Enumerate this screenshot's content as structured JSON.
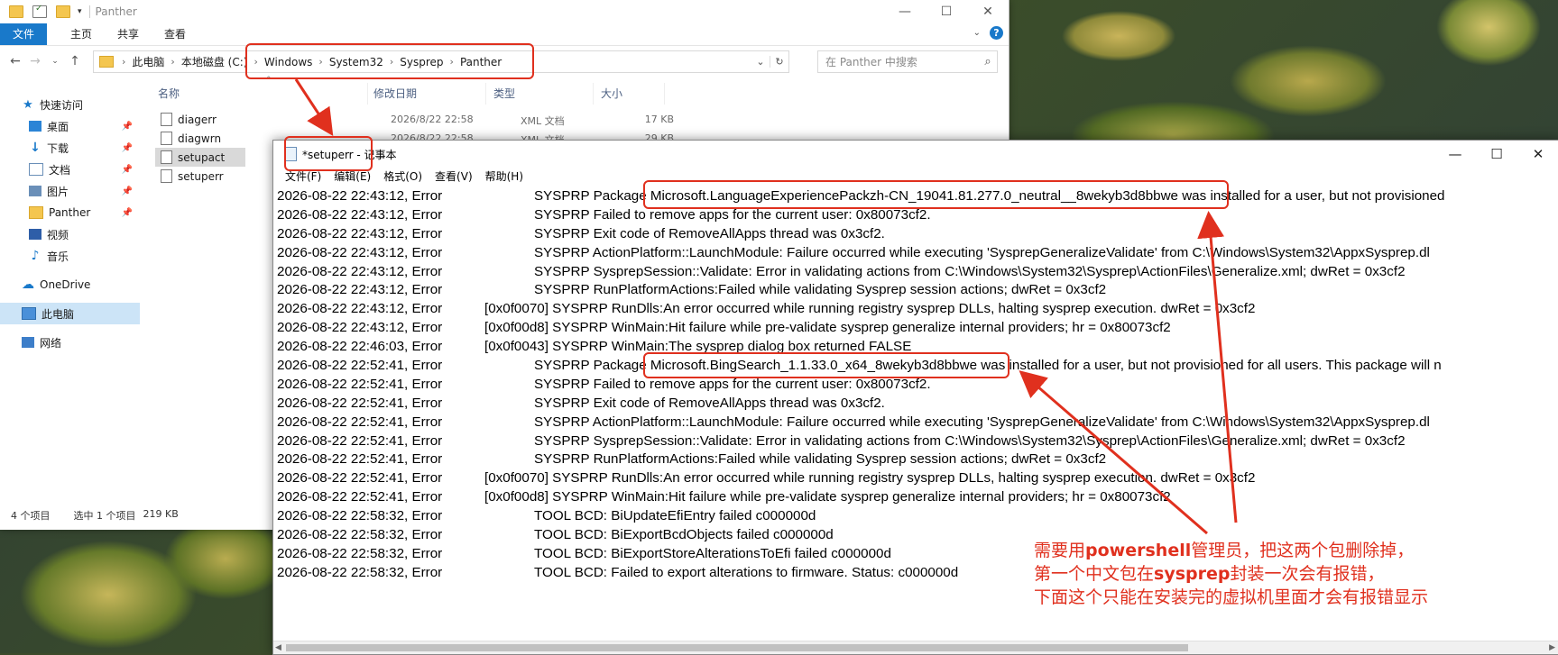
{
  "explorer": {
    "window_title": "Panther",
    "ribbon_tabs": [
      "文件",
      "主页",
      "共享",
      "查看"
    ],
    "breadcrumbs": [
      "此电脑",
      "本地磁盘 (C:)",
      "Windows",
      "System32",
      "Sysprep",
      "Panther"
    ],
    "search_placeholder": "在 Panther 中搜索",
    "nav_items": [
      {
        "label": "快速访问",
        "icon": "star-icon"
      },
      {
        "label": "桌面",
        "icon": "desktop-icon",
        "pinned": true
      },
      {
        "label": "下载",
        "icon": "download-icon",
        "pinned": true
      },
      {
        "label": "文档",
        "icon": "document-icon",
        "pinned": true
      },
      {
        "label": "图片",
        "icon": "pictures-icon",
        "pinned": true
      },
      {
        "label": "Panther",
        "icon": "folder-icon",
        "pinned": true
      },
      {
        "label": "视频",
        "icon": "video-icon"
      },
      {
        "label": "音乐",
        "icon": "music-icon"
      },
      {
        "label": "OneDrive",
        "icon": "cloud-icon"
      },
      {
        "label": "此电脑",
        "icon": "computer-icon",
        "selected": true
      },
      {
        "label": "网络",
        "icon": "network-icon"
      }
    ],
    "columns": [
      "名称",
      "修改日期",
      "类型",
      "大小"
    ],
    "files": [
      {
        "name": "diagerr",
        "date": "2026/8/22 22:58",
        "type": "XML 文档",
        "size": "17 KB"
      },
      {
        "name": "diagwrn",
        "date": "2026/8/22 22:58",
        "type": "XML 文档",
        "size": "29 KB"
      },
      {
        "name": "setupact",
        "date": "",
        "type": "",
        "size": "",
        "selected": true
      },
      {
        "name": "setuperr",
        "date": "",
        "type": "",
        "size": ""
      }
    ],
    "status": {
      "count": "4 个项目",
      "selected": "选中 1 个项目",
      "size": "219 KB"
    }
  },
  "notepad": {
    "title": "*setuperr - 记事本",
    "menu": [
      "文件(F)",
      "编辑(E)",
      "格式(O)",
      "查看(V)",
      "帮助(H)"
    ],
    "lines": [
      {
        "ts": "2026-08-22 22:43:12, Error",
        "msg": "SYSPRP Package Microsoft.LanguageExperiencePackzh-CN_19041.81.277.0_neutral__8wekyb3d8bbwe was installed for a user, but not provisioned",
        "indent": "wide"
      },
      {
        "ts": "2026-08-22 22:43:12, Error",
        "msg": "SYSPRP Failed to remove apps for the current user: 0x80073cf2.",
        "indent": "wide"
      },
      {
        "ts": "2026-08-22 22:43:12, Error",
        "msg": "SYSPRP Exit code of RemoveAllApps thread was 0x3cf2.",
        "indent": "wide"
      },
      {
        "ts": "2026-08-22 22:43:12, Error",
        "msg": "SYSPRP ActionPlatform::LaunchModule: Failure occurred while executing 'SysprepGeneralizeValidate' from C:\\Windows\\System32\\AppxSysprep.dl",
        "indent": "wide"
      },
      {
        "ts": "2026-08-22 22:43:12, Error",
        "msg": "SYSPRP SysprepSession::Validate: Error in validating actions from C:\\Windows\\System32\\Sysprep\\ActionFiles\\Generalize.xml; dwRet = 0x3cf2",
        "indent": "wide"
      },
      {
        "ts": "2026-08-22 22:43:12, Error",
        "msg": "SYSPRP RunPlatformActions:Failed while validating Sysprep session actions; dwRet = 0x3cf2",
        "indent": "wide"
      },
      {
        "ts": "2026-08-22 22:43:12, Error",
        "msg": "[0x0f0070] SYSPRP RunDlls:An error occurred while running registry sysprep DLLs, halting sysprep execution. dwRet = 0x3cf2",
        "indent": "narrow"
      },
      {
        "ts": "2026-08-22 22:43:12, Error",
        "msg": "[0x0f00d8] SYSPRP WinMain:Hit failure while pre-validate sysprep generalize internal providers; hr = 0x80073cf2",
        "indent": "narrow"
      },
      {
        "ts": "2026-08-22 22:46:03, Error",
        "msg": "[0x0f0043] SYSPRP WinMain:The sysprep dialog box returned FALSE",
        "indent": "narrow"
      },
      {
        "ts": "2026-08-22 22:52:41, Error",
        "msg": "SYSPRP Package Microsoft.BingSearch_1.1.33.0_x64_8wekyb3d8bbwe was installed for a user, but not provisioned for all users. This package will n",
        "indent": "wide"
      },
      {
        "ts": "2026-08-22 22:52:41, Error",
        "msg": "SYSPRP Failed to remove apps for the current user: 0x80073cf2.",
        "indent": "wide"
      },
      {
        "ts": "2026-08-22 22:52:41, Error",
        "msg": "SYSPRP Exit code of RemoveAllApps thread was 0x3cf2.",
        "indent": "wide"
      },
      {
        "ts": "2026-08-22 22:52:41, Error",
        "msg": "SYSPRP ActionPlatform::LaunchModule: Failure occurred while executing 'SysprepGeneralizeValidate' from C:\\Windows\\System32\\AppxSysprep.dl",
        "indent": "wide"
      },
      {
        "ts": "2026-08-22 22:52:41, Error",
        "msg": "SYSPRP SysprepSession::Validate: Error in validating actions from C:\\Windows\\System32\\Sysprep\\ActionFiles\\Generalize.xml; dwRet = 0x3cf2",
        "indent": "wide"
      },
      {
        "ts": "2026-08-22 22:52:41, Error",
        "msg": "SYSPRP RunPlatformActions:Failed while validating Sysprep session actions; dwRet = 0x3cf2",
        "indent": "wide"
      },
      {
        "ts": "2026-08-22 22:52:41, Error",
        "msg": "[0x0f0070] SYSPRP RunDlls:An error occurred while running registry sysprep DLLs, halting sysprep execution. dwRet = 0x3cf2",
        "indent": "narrow"
      },
      {
        "ts": "2026-08-22 22:52:41, Error",
        "msg": "[0x0f00d8] SYSPRP WinMain:Hit failure while pre-validate sysprep generalize internal providers; hr = 0x80073cf2",
        "indent": "narrow"
      },
      {
        "ts": "2026-08-22 22:58:32, Error",
        "msg": "TOOL   BCD: BiUpdateEfiEntry failed c000000d",
        "indent": "wide"
      },
      {
        "ts": "2026-08-22 22:58:32, Error",
        "msg": "TOOL   BCD: BiExportBcdObjects failed c000000d",
        "indent": "wide"
      },
      {
        "ts": "2026-08-22 22:58:32, Error",
        "msg": "TOOL   BCD: BiExportStoreAlterationsToEfi failed c000000d",
        "indent": "wide"
      },
      {
        "ts": "2026-08-22 22:58:32, Error",
        "msg": "TOOL   BCD: Failed to export alterations to firmware. Status: c000000d",
        "indent": "wide"
      }
    ]
  },
  "annotation": {
    "color": "#e0301e",
    "lines": [
      "需要用powershell管理员，把这两个包删除掉，",
      "第一个中文包在sysprep封装一次会有报错，",
      "下面这个只能在安装完的虚拟机里面才会有报错显示"
    ]
  }
}
